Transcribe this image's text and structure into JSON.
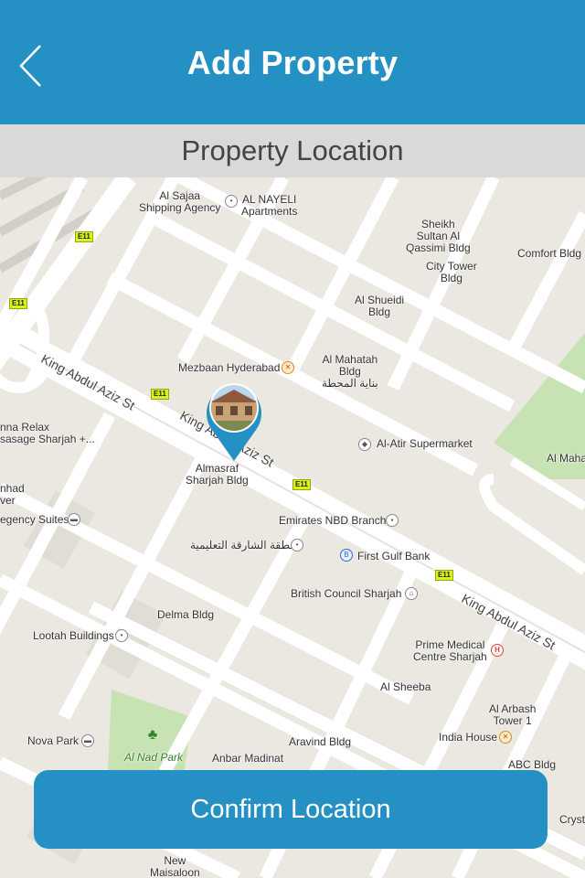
{
  "header": {
    "title": "Add Property",
    "back_icon": "chevron-left-icon"
  },
  "subheader": {
    "title": "Property Location"
  },
  "map": {
    "streets": [
      "King Abdul Aziz St",
      "King Abdul Aziz St",
      "King Abdul Aziz St"
    ],
    "road_shields": [
      "E11",
      "E11",
      "E11",
      "E11",
      "E11"
    ],
    "places": {
      "al_sajaa": "Al Sajaa\nShipping Agency",
      "al_nayeli": "AL NAYELI\nApartments",
      "sheikh_sultan": "Sheikh\nSultan Al\nQassimi Bldg",
      "comfort": "Comfort Bldg",
      "city_tower": "City Tower\nBldg",
      "al_shueidi": "Al Shueidi\nBldg",
      "mezbaan": "Mezbaan Hyderabad",
      "al_mahatah": "Al Mahatah\nBldg\nبناية المحطة",
      "al_atir": "Al-Atir Supermarket",
      "al_maha": "Al Maha",
      "relax": "nna Relax\nsasage Sharjah +...",
      "almasraf": "Almasraf\nSharjah Bldg",
      "emirates_nbd": "Emirates NBD Branch",
      "nhad": "nhad\nver",
      "regency": "egency Suites",
      "arabic_zone": "منطقة الشارقة التعليمية",
      "first_gulf": "First Gulf Bank",
      "british_council": "British Council Sharjah",
      "delma": "Delma Bldg",
      "lootah": "Lootah Buildings",
      "prime_medical": "Prime Medical\nCentre Sharjah",
      "al_sheeba": "Al Sheeba",
      "al_arbash": "Al Arbash\nTower 1",
      "nova_park": "Nova Park",
      "al_nad_park": "Al Nad Park",
      "aravind": "Aravind Bldg",
      "india_house": "India House",
      "abc_bldg": "ABC Bldg",
      "anbar": "Anbar Madinat",
      "new_maisaloon": "New\nMaisaloon",
      "cryst": "Cryst"
    },
    "pin_icon": "location-pin-icon"
  },
  "confirm_button": {
    "label": "Confirm Location"
  },
  "colors": {
    "primary": "#2590c4",
    "subheader_bg": "#d9d9d9",
    "map_bg": "#ebe8e1",
    "park_green": "#c7e3b4"
  }
}
